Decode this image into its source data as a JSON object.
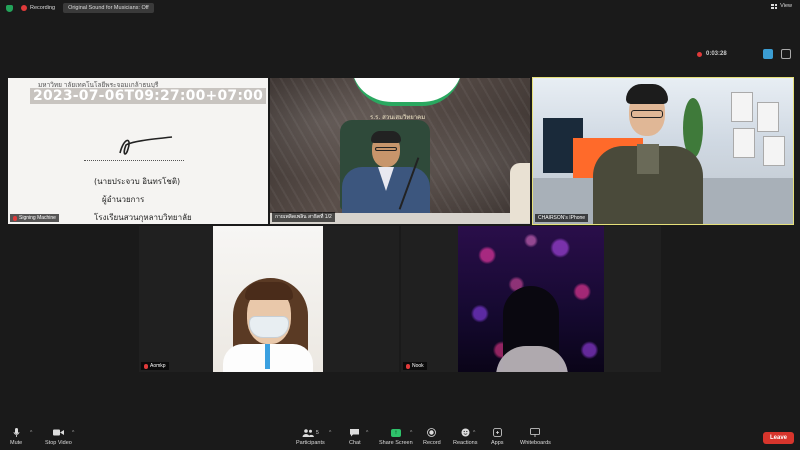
{
  "topbar": {
    "recording_label": "Recording",
    "original_sound_label": "Original Sound for Musicians: Off",
    "view_label": "View"
  },
  "timer": {
    "elapsed": "0:03:28"
  },
  "tiles": [
    {
      "name": "Signing Machine",
      "document": {
        "header": "มหาวิทย าลัยเทคโนโลยีพระจอมเกล้าธนบุรี",
        "timestamp": "2023-07-06T09:27:00+07:00",
        "line1": "(นายประจวบ อินทรโชติ)",
        "line2": "ผู้อำนวยการ",
        "line3": "โรงเรียนสวนกุหลาบวิทยาลัย"
      }
    },
    {
      "name": "กายเพลิดเพลิน สาธิตที่ 1/2",
      "logo_text": "ร.ร. สวนเสมวิทยาคม"
    },
    {
      "name": "CHAIRSON's IPhone"
    },
    {
      "name": "Aomkp"
    },
    {
      "name": "Nook"
    }
  ],
  "toolbar": {
    "mute": "Mute",
    "stop_video": "Stop Video",
    "participants": "Participants",
    "participants_count": "5",
    "chat": "Chat",
    "share_screen": "Share Screen",
    "record": "Record",
    "reactions": "Reactions",
    "apps": "Apps",
    "whiteboards": "Whiteboards",
    "leave": "Leave"
  },
  "colors": {
    "background": "#1a1a1a",
    "active_speaker_border": "#e6e07a",
    "share_green": "#2ec26a",
    "leave_red": "#d7352c",
    "recording_red": "#e03a3a"
  }
}
